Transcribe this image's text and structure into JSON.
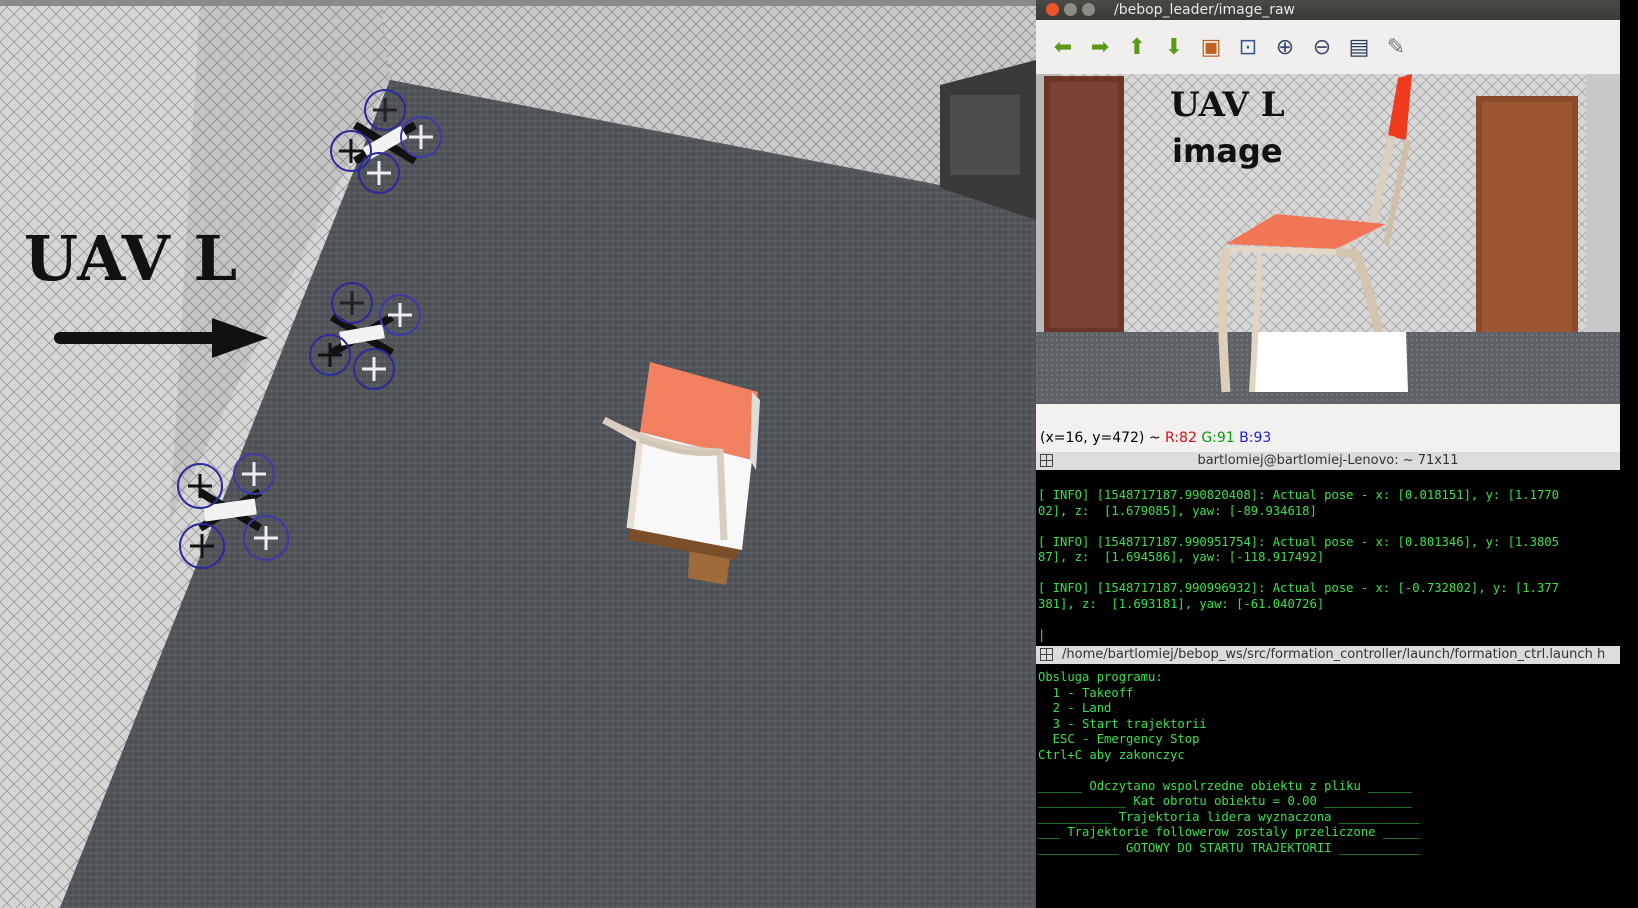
{
  "sim_view": {
    "overlay_label": "UAV L"
  },
  "viewer": {
    "window_title": "/bebop_leader/image_raw",
    "toolbar": [
      {
        "icon": "arrow-left-icon",
        "glyph": "⬅",
        "color": "#5a9a1a"
      },
      {
        "icon": "arrow-right-icon",
        "glyph": "➡",
        "color": "#5a9a1a"
      },
      {
        "icon": "arrow-up-icon",
        "glyph": "⬆",
        "color": "#5a9a1a"
      },
      {
        "icon": "arrow-down-icon",
        "glyph": "⬇",
        "color": "#5a9a1a"
      },
      {
        "icon": "image-icon",
        "glyph": "▣",
        "color": "#c06020"
      },
      {
        "icon": "zoom-fit-icon",
        "glyph": "⊡",
        "color": "#3a5a8a"
      },
      {
        "icon": "zoom-in-icon",
        "glyph": "⊕",
        "color": "#3a4a6a"
      },
      {
        "icon": "zoom-out-icon",
        "glyph": "⊖",
        "color": "#3a4a6a"
      },
      {
        "icon": "save-icon",
        "glyph": "▤",
        "color": "#2a3a5a"
      },
      {
        "icon": "brush-icon",
        "glyph": "✎",
        "color": "#777777"
      }
    ],
    "image_label_line1": "UAV L",
    "image_label_line2": "image",
    "status": {
      "coords": "(x=16, y=472) ~",
      "r": "R:82",
      "g": "G:91",
      "b": "B:93"
    }
  },
  "terminal1": {
    "title": "bartlomiej@bartlomiej-Lenovo: ~ 71x11",
    "text": "[ INFO] [1548717187.990820408]: Actual pose - x: [0.018151], y: [1.1770\n02], z:  [1.679085], yaw: [-89.934618]\n\n[ INFO] [1548717187.990951754]: Actual pose - x: [0.801346], y: [1.3805\n87], z:  [1.694586], yaw: [-118.917492]\n\n[ INFO] [1548717187.990996932]: Actual pose - x: [-0.732802], y: [1.377\n381], z:  [1.693181], yaw: [-61.040726]\n\n|"
  },
  "terminal2": {
    "title": "/home/bartlomiej/bebop_ws/src/formation_controller/launch/formation_ctrl.launch h",
    "text": "Obsluga programu:\n  1 - Takeoff\n  2 - Land\n  3 - Start trajektorii\n  ESC - Emergency Stop\nCtrl+C aby zakonczyc\n\n______ Odczytano wspolrzedne obiektu z pliku ______\n____________ Kat obrotu obiektu = 0.00 ____________\n__________ Trajektoria lidera wyznaczona ___________\n___ Trajektorie followerow zostaly przeliczone _____\n___________ GOTOWY DO STARTU TRAJEKTORII ___________"
  }
}
